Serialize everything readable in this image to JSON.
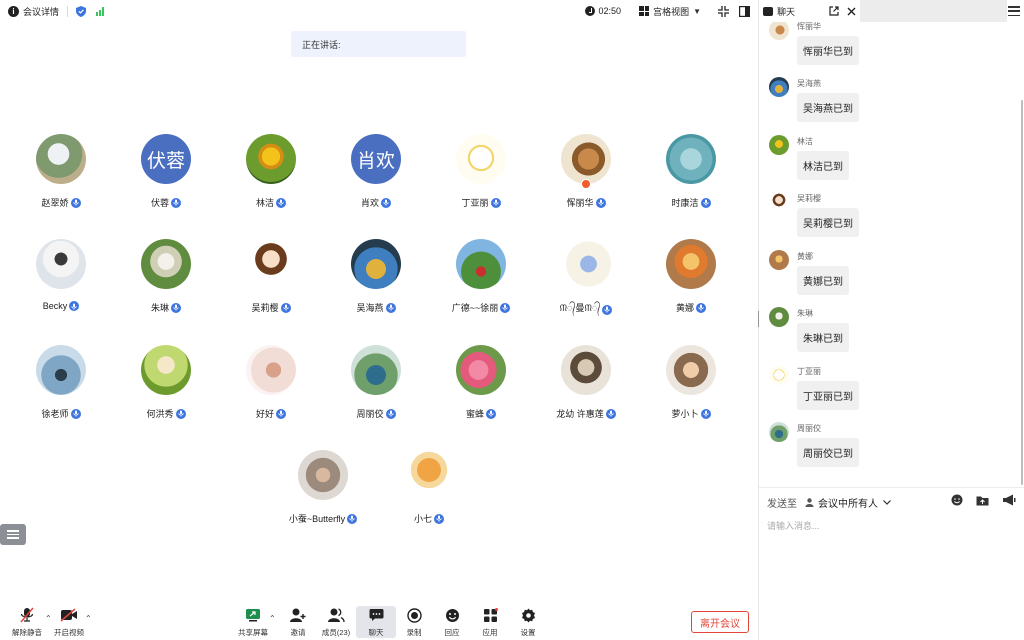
{
  "topbar": {
    "meeting_info_label": "会议详情",
    "timer": "02:50",
    "view_mode": "宫格视图"
  },
  "speaking": {
    "label": "正在讲话:"
  },
  "participants": [
    {
      "name": "赵翠娇"
    },
    {
      "name": "伏蓉",
      "avatar_text": "伏蓉"
    },
    {
      "name": "林洁"
    },
    {
      "name": "肖欢",
      "avatar_text": "肖欢"
    },
    {
      "name": "丁亚丽"
    },
    {
      "name": "恽丽华"
    },
    {
      "name": "时康洁"
    },
    {
      "name": "Becky"
    },
    {
      "name": "朱琳"
    },
    {
      "name": "吴莉樱"
    },
    {
      "name": "吴海燕"
    },
    {
      "name": "广德~~徐丽"
    },
    {
      "name": "ᙏ᭄曼ᙏ᭄"
    },
    {
      "name": "黄娜"
    },
    {
      "name": "徐老师"
    },
    {
      "name": "何洪秀"
    },
    {
      "name": "好好"
    },
    {
      "name": "周丽佼"
    },
    {
      "name": "蜜蜂"
    },
    {
      "name": "龙幼 许惠莲"
    },
    {
      "name": "萝小卜"
    },
    {
      "name": "小蚕~Butterfly"
    },
    {
      "name": "小七"
    }
  ],
  "toolbar": {
    "unmute": "解除静音",
    "start_video": "开启视频",
    "share_screen": "共享屏幕",
    "invite": "邀请",
    "members": "成员(23)",
    "chat": "聊天",
    "record": "录制",
    "reactions": "回应",
    "apps": "应用",
    "settings": "设置",
    "leave": "离开会议"
  },
  "chat": {
    "title": "聊天",
    "messages": [
      {
        "sender": "恽丽华",
        "text": "恽丽华已到"
      },
      {
        "sender": "吴海燕",
        "text": "吴海燕已到"
      },
      {
        "sender": "林洁",
        "text": "林洁已到"
      },
      {
        "sender": "吴莉樱",
        "text": "吴莉樱已到"
      },
      {
        "sender": "黄娜",
        "text": "黄娜已到"
      },
      {
        "sender": "朱琳",
        "text": "朱琳已到"
      },
      {
        "sender": "丁亚丽",
        "text": "丁亚丽已到"
      },
      {
        "sender": "周丽佼",
        "text": "周丽佼已到"
      }
    ],
    "send_to_label": "发送至",
    "send_to_target": "会议中所有人",
    "input_placeholder": "请输入消息..."
  },
  "colors": {
    "accent_blue": "#3d74e0",
    "avatar_text_bg": "#4a6fc1",
    "leave_red": "#e4453a",
    "signal_green": "#34c759"
  }
}
